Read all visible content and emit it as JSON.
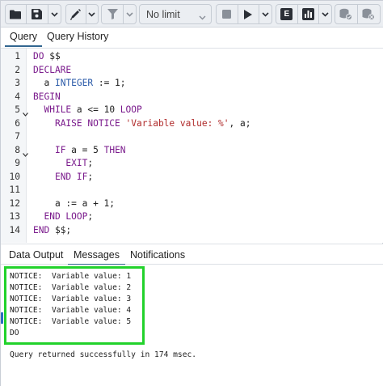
{
  "toolbar": {
    "limit_label": "No limit",
    "icons": [
      "folder-icon",
      "save-icon",
      "chevron-down-icon",
      "pencil-icon",
      "chevron-down-icon",
      "filter-icon",
      "chevron-down-icon",
      "stop-icon",
      "play-icon",
      "chevron-down-icon",
      "explain-icon",
      "analyze-icon",
      "chevron-down-icon",
      "commit-icon",
      "rollback-icon"
    ],
    "explain_letter": "E"
  },
  "editor_tabs": [
    "Query",
    "Query History"
  ],
  "code_lines": [
    {
      "n": "1",
      "fold": false,
      "tokens": [
        {
          "t": "kw",
          "v": "DO"
        },
        {
          "t": "plain",
          "v": " $$"
        }
      ]
    },
    {
      "n": "2",
      "fold": false,
      "tokens": [
        {
          "t": "kw",
          "v": "DECLARE"
        }
      ]
    },
    {
      "n": "3",
      "fold": false,
      "tokens": [
        {
          "t": "plain",
          "v": "  a "
        },
        {
          "t": "ty",
          "v": "INTEGER"
        },
        {
          "t": "plain",
          "v": " := 1;"
        }
      ]
    },
    {
      "n": "4",
      "fold": false,
      "tokens": [
        {
          "t": "kw",
          "v": "BEGIN"
        }
      ]
    },
    {
      "n": "5",
      "fold": true,
      "tokens": [
        {
          "t": "plain",
          "v": "  "
        },
        {
          "t": "kw",
          "v": "WHILE"
        },
        {
          "t": "plain",
          "v": " a <= 10 "
        },
        {
          "t": "kw",
          "v": "LOOP"
        }
      ]
    },
    {
      "n": "6",
      "fold": false,
      "tokens": [
        {
          "t": "plain",
          "v": "    "
        },
        {
          "t": "kw",
          "v": "RAISE NOTICE"
        },
        {
          "t": "plain",
          "v": " "
        },
        {
          "t": "str",
          "v": "'Variable value: %'"
        },
        {
          "t": "plain",
          "v": ", a;"
        }
      ]
    },
    {
      "n": "7",
      "fold": false,
      "tokens": []
    },
    {
      "n": "8",
      "fold": true,
      "tokens": [
        {
          "t": "plain",
          "v": "    "
        },
        {
          "t": "kw",
          "v": "IF"
        },
        {
          "t": "plain",
          "v": " a = 5 "
        },
        {
          "t": "kw",
          "v": "THEN"
        }
      ]
    },
    {
      "n": "9",
      "fold": false,
      "tokens": [
        {
          "t": "plain",
          "v": "      "
        },
        {
          "t": "kw",
          "v": "EXIT"
        },
        {
          "t": "plain",
          "v": ";"
        }
      ]
    },
    {
      "n": "10",
      "fold": false,
      "tokens": [
        {
          "t": "plain",
          "v": "    "
        },
        {
          "t": "kw",
          "v": "END IF"
        },
        {
          "t": "plain",
          "v": ";"
        }
      ]
    },
    {
      "n": "11",
      "fold": false,
      "tokens": []
    },
    {
      "n": "12",
      "fold": false,
      "tokens": [
        {
          "t": "plain",
          "v": "    a := a + 1;"
        }
      ]
    },
    {
      "n": "13",
      "fold": false,
      "tokens": [
        {
          "t": "plain",
          "v": "  "
        },
        {
          "t": "kw",
          "v": "END LOOP"
        },
        {
          "t": "plain",
          "v": ";"
        }
      ]
    },
    {
      "n": "14",
      "fold": false,
      "tokens": [
        {
          "t": "kw",
          "v": "END"
        },
        {
          "t": "plain",
          "v": " $$;"
        }
      ]
    }
  ],
  "output_tabs": [
    "Data Output",
    "Messages",
    "Notifications"
  ],
  "messages": [
    "NOTICE:  Variable value: 1",
    "NOTICE:  Variable value: 2",
    "NOTICE:  Variable value: 3",
    "NOTICE:  Variable value: 4",
    "NOTICE:  Variable value: 5",
    "DO"
  ],
  "status_message": "Query returned successfully in 174 msec.",
  "colors": {
    "keyword": "#7a1a8c",
    "type": "#2a5aa8",
    "string": "#b02b2b",
    "highlight_box": "#22d22b",
    "active_tab_underline": "#326690"
  }
}
